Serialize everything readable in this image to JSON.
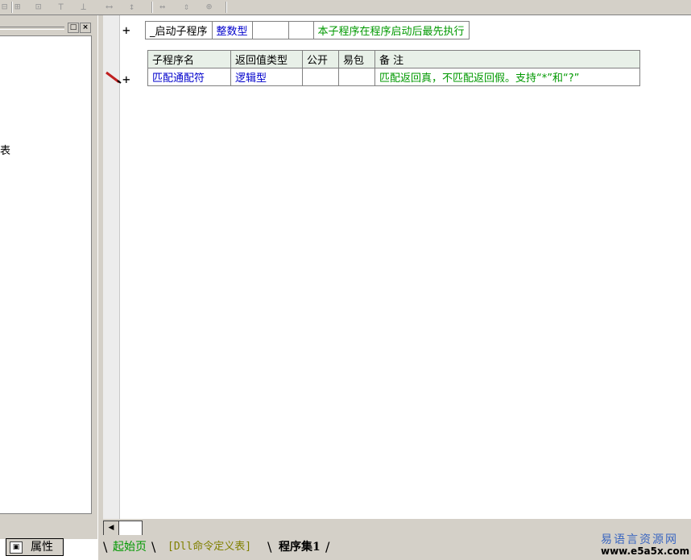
{
  "left_panel": {
    "text_fragment": "表",
    "properties_tab": "属性",
    "restore_button": "□",
    "close_button": "×"
  },
  "editor": {
    "startup_row": {
      "name": "_启动子程序",
      "return_type": "整数型",
      "public": "",
      "easy_pkg": "",
      "note": "本子程序在程序启动后最先执行"
    },
    "table_headers": [
      "子程序名",
      "返回值类型",
      "公开",
      "易包",
      "备 注"
    ],
    "sub_row": {
      "name": "匹配通配符",
      "return_type": "逻辑型",
      "public": "",
      "easy_pkg": "",
      "note": "匹配返回真，不匹配返回假。支持“*”和“?”"
    },
    "expand_glyph": "+"
  },
  "tabs": [
    "起始页",
    "[Dll命令定义表]",
    "程序集1"
  ],
  "watermark": {
    "line1": "易语言资源网",
    "line2": "www.e5a5x.com"
  },
  "colors": {
    "type_blue": "#0000cc",
    "note_green": "#009900",
    "chrome": "#d4d0c8",
    "tab_inactive_text": "#009900"
  },
  "icons": [
    "toolbar-align-icons",
    "pencil-icon",
    "properties-icon",
    "scroll-left-icon"
  ]
}
